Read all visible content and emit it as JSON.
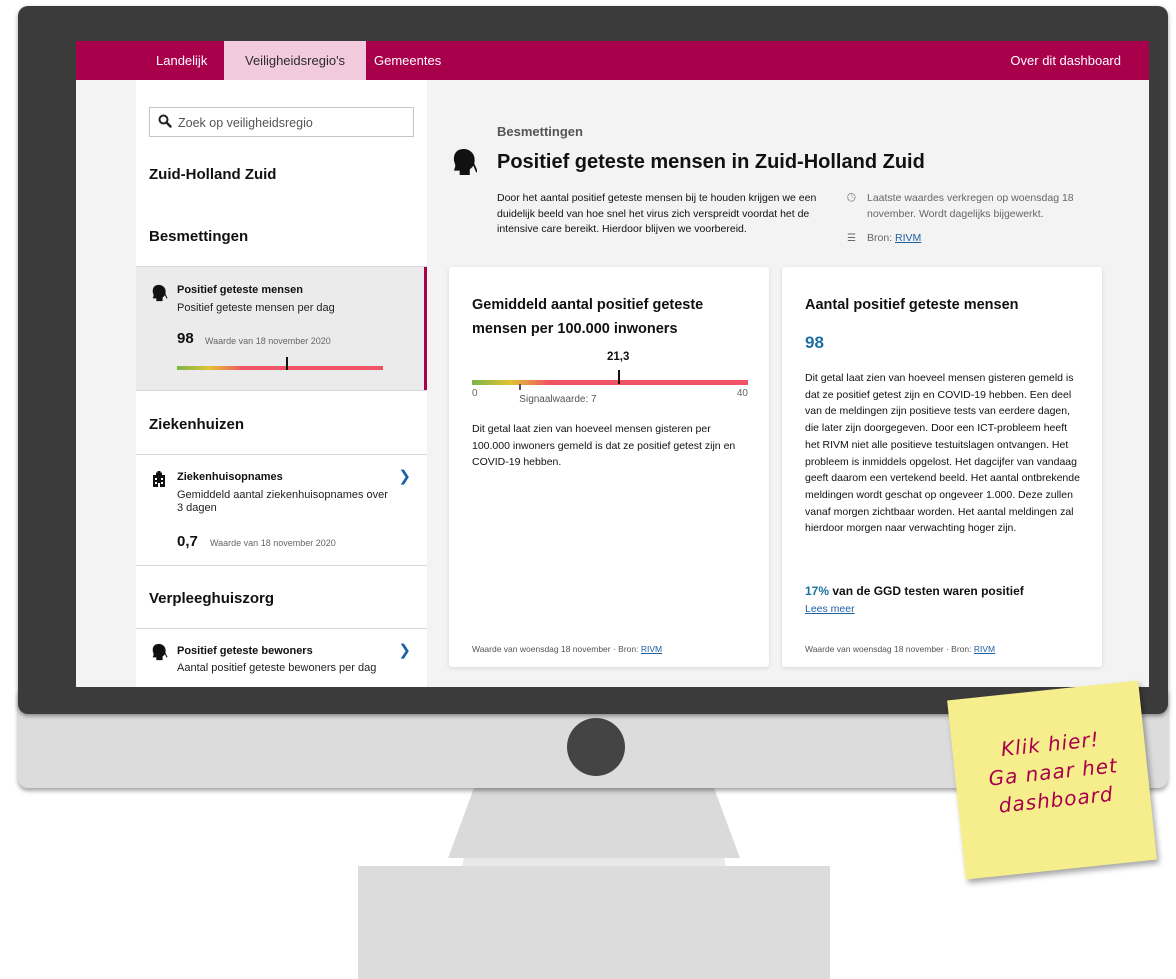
{
  "nav": {
    "tabs": [
      {
        "label": "Landelijk",
        "active": false
      },
      {
        "label": "Veiligheidsregio's",
        "active": true
      },
      {
        "label": "Gemeentes",
        "active": false
      }
    ],
    "right_link": "Over dit dashboard"
  },
  "sidebar": {
    "search_placeholder": "Zoek op veiligheidsregio",
    "region": "Zuid-Holland Zuid",
    "sections": [
      {
        "heading": "Besmettingen",
        "items": [
          {
            "title": "Positief geteste mensen",
            "subtitle": "Positief geteste mensen per dag",
            "value": "98",
            "value_note": "Waarde van 18 november 2020",
            "icon": "head-icon",
            "active": true,
            "bar_level": 0.53
          }
        ]
      },
      {
        "heading": "Ziekenhuizen",
        "items": [
          {
            "title": "Ziekenhuisopnames",
            "subtitle": "Gemiddeld aantal ziekenhuisopnames over 3 dagen",
            "value": "0,7",
            "value_note": "Waarde van 18 november 2020",
            "icon": "hospital-icon",
            "active": false
          }
        ]
      },
      {
        "heading": "Verpleeghuiszorg",
        "items": [
          {
            "title": "Positief geteste bewoners",
            "subtitle": "Aantal positief geteste bewoners per dag",
            "icon": "head-icon",
            "active": false
          }
        ]
      }
    ]
  },
  "main": {
    "kicker": "Besmettingen",
    "title": "Positief geteste mensen in Zuid-Holland Zuid",
    "intro": "Door het aantal positief geteste mensen bij te houden krijgen we een duidelijk beeld van hoe snel het virus zich verspreidt voordat het de intensive care bereikt. Hierdoor blijven we voorbereid.",
    "meta_updated": "Laatste waardes verkregen op woensdag 18 november. Wordt dagelijks bijgewerkt.",
    "meta_source_prefix": "Bron:",
    "meta_source_link": "RIVM",
    "cards": [
      {
        "title": "Gemiddeld aantal positief geteste mensen per 100.000 inwoners",
        "gauge": {
          "value": 21.3,
          "value_label": "21,3",
          "min_label": "0",
          "max_label": "40",
          "min": 0,
          "max": 40,
          "signal_value": 7,
          "signal_label": "Signaalwaarde: 7"
        },
        "body": "Dit getal laat zien van hoeveel mensen gisteren per 100.000 inwoners gemeld is dat ze positief getest zijn en COVID-19 hebben.",
        "footer_prefix": "Waarde van woensdag 18 november · Bron:",
        "footer_link": "RIVM"
      },
      {
        "title": "Aantal positief geteste mensen",
        "value": "98",
        "body": "Dit getal laat zien van hoeveel mensen gisteren gemeld is dat ze positief getest zijn en COVID-19 hebben. Een deel van de meldingen zijn positieve tests van eerdere dagen, die later zijn doorgegeven. Door een ICT-probleem heeft het RIVM niet alle positieve testuitslagen ontvangen. Het probleem is inmiddels opgelost. Het dagcijfer van vandaag geeft daarom een vertekend beeld. Het aantal ontbrekende meldingen wordt geschat op ongeveer 1.000. Deze zullen vanaf morgen zichtbaar worden. Het aantal meldingen zal hierdoor morgen naar verwachting hoger zijn.",
        "pct": "17%",
        "pct_text": "van de GGD testen waren positief",
        "read_more": "Lees meer",
        "footer_prefix": "Waarde van woensdag 18 november · Bron:",
        "footer_link": "RIVM"
      }
    ]
  },
  "sticky_note": {
    "lines": [
      "Klik hier!",
      "Ga naar het",
      "dashboard"
    ]
  },
  "colors": {
    "brand": "#a9004b",
    "active_tab": "#f2cadd",
    "link": "#1f5fa3",
    "number": "#1f6fa3",
    "gauge_green": "#7ab648",
    "gauge_yellow": "#e2c232",
    "gauge_red": "#f05365",
    "sticky": "#f6ee8c"
  }
}
